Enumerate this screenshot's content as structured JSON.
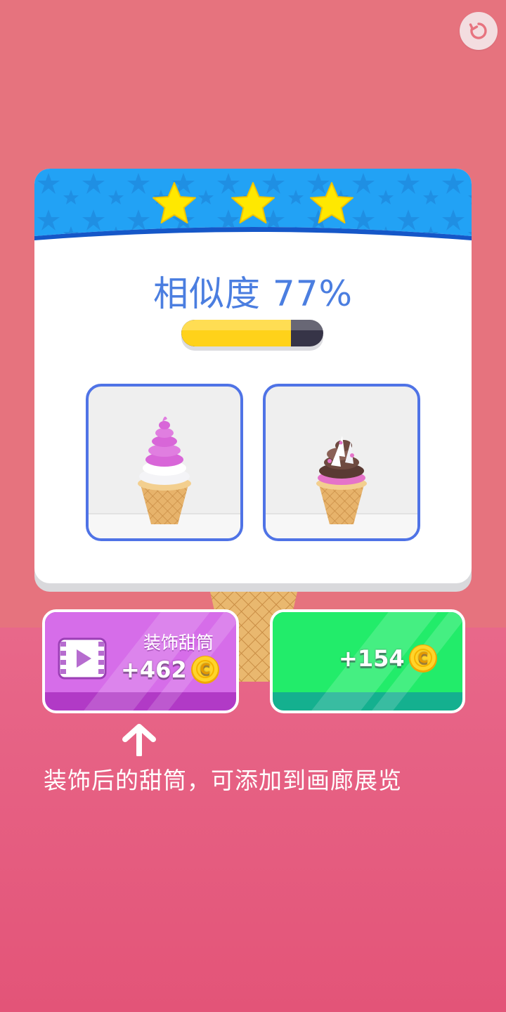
{
  "icons": {
    "restart": "restart-icon",
    "star": "star-icon",
    "video": "video-icon",
    "coin": "coin-icon",
    "arrow": "up-arrow-icon"
  },
  "result": {
    "stars_earned": 3,
    "stars_total": 3,
    "similarity_label": "相似度 77%",
    "similarity_value": 0.77
  },
  "images": [
    {
      "name": "target-cone",
      "swirl": "pink-white"
    },
    {
      "name": "player-cone",
      "swirl": "chocolate-pink-sprinkles"
    }
  ],
  "buttons": {
    "decorate": {
      "title": "装饰甜筒",
      "reward": "+462"
    },
    "claim": {
      "reward": "+154"
    }
  },
  "tip": "装饰后的甜筒，可添加到画廊展览",
  "colors": {
    "accent_blue": "#4b7ee0",
    "header_blue": "#22a2f5",
    "progress_fill": "#ffd21a",
    "decorate_button": "#d66de9",
    "claim_button": "#22ec6a",
    "background_top": "#e6737e",
    "background_bottom": "#e35478"
  }
}
